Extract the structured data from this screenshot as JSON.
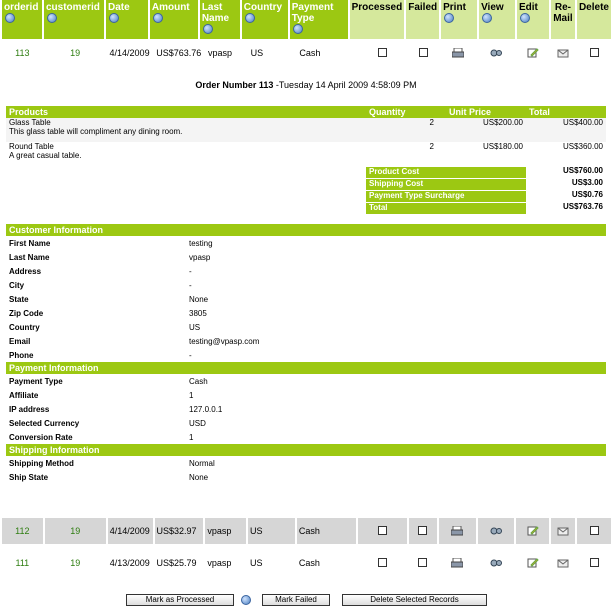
{
  "columns": [
    {
      "key": "orderid",
      "label": "orderid",
      "info": true
    },
    {
      "key": "customerid",
      "label": "customerid",
      "info": true
    },
    {
      "key": "date",
      "label": "Date",
      "info": true
    },
    {
      "key": "amount",
      "label": "Amount",
      "info": true
    },
    {
      "key": "lastname",
      "label": "Last Name",
      "info": true
    },
    {
      "key": "country",
      "label": "Country",
      "info": true
    },
    {
      "key": "ptype",
      "label": "Payment Type",
      "info": true
    },
    {
      "key": "processed",
      "label": "Processed",
      "info": false
    },
    {
      "key": "failed",
      "label": "Failed",
      "info": false
    },
    {
      "key": "print",
      "label": "Print",
      "info": true
    },
    {
      "key": "view",
      "label": "View",
      "info": true
    },
    {
      "key": "edit",
      "label": "Edit",
      "info": true
    },
    {
      "key": "remail",
      "label": "Re-Mail",
      "info": false
    },
    {
      "key": "delete",
      "label": "Delete",
      "info": false
    }
  ],
  "orders": [
    {
      "orderid": "113",
      "customerid": "19",
      "date": "4/14/2009",
      "amount": "US$763.76",
      "lastname": "vpasp",
      "country": "US",
      "ptype": "Cash"
    },
    {
      "orderid": "112",
      "customerid": "19",
      "date": "4/14/2009",
      "amount": "US$32.97",
      "lastname": "vpasp",
      "country": "US",
      "ptype": "Cash"
    },
    {
      "orderid": "111",
      "customerid": "19",
      "date": "4/13/2009",
      "amount": "US$25.79",
      "lastname": "vpasp",
      "country": "US",
      "ptype": "Cash"
    }
  ],
  "detail": {
    "title_bold": "Order Number 113",
    "title_rest": " -Tuesday 14 April 2009 4:58:09 PM",
    "products_header": {
      "name": "Products",
      "qty": "Quantity",
      "price": "Unit Price",
      "total": "Total"
    },
    "products": [
      {
        "name": "Glass Table",
        "desc": "This glass table will compliment any dining room.",
        "qty": "2",
        "price": "US$200.00",
        "total": "US$400.00"
      },
      {
        "name": "Round Table",
        "desc": "A great casual table.",
        "qty": "2",
        "price": "US$180.00",
        "total": "US$360.00"
      }
    ],
    "totals": [
      {
        "label": "Product Cost",
        "value": "US$760.00"
      },
      {
        "label": "Shipping Cost",
        "value": "US$3.00"
      },
      {
        "label": "Payment Type Surcharge",
        "value": "US$0.76"
      },
      {
        "label": "Total",
        "value": "US$763.76"
      }
    ],
    "sections": [
      {
        "title": "Customer Information",
        "rows": [
          {
            "k": "First Name",
            "v": "testing"
          },
          {
            "k": "Last Name",
            "v": "vpasp"
          },
          {
            "k": "Address",
            "v": "-"
          },
          {
            "k": "City",
            "v": "-"
          },
          {
            "k": "State",
            "v": "None"
          },
          {
            "k": "Zip Code",
            "v": "3805"
          },
          {
            "k": "Country",
            "v": "US"
          },
          {
            "k": "Email",
            "v": "testing@vpasp.com"
          },
          {
            "k": "Phone",
            "v": "-"
          }
        ]
      },
      {
        "title": "Payment Information",
        "rows": [
          {
            "k": "Payment Type",
            "v": "Cash"
          },
          {
            "k": "Affiliate",
            "v": "1"
          },
          {
            "k": "IP address",
            "v": "127.0.0.1"
          },
          {
            "k": "Selected Currency",
            "v": "USD"
          },
          {
            "k": "Conversion Rate",
            "v": "1"
          }
        ]
      },
      {
        "title": "Shipping Information",
        "rows": [
          {
            "k": "Shipping Method",
            "v": "Normal"
          },
          {
            "k": "Ship State",
            "v": "None"
          }
        ]
      }
    ]
  },
  "buttons": {
    "mark_processed": "Mark as Processed",
    "mark_failed": "Mark Failed",
    "delete_selected": "Delete Selected Records"
  },
  "colors": {
    "header": "#9cc812",
    "header_light": "#d5e89c",
    "row_alt": "#d6d6d6",
    "id_text": "#2e7d10"
  }
}
